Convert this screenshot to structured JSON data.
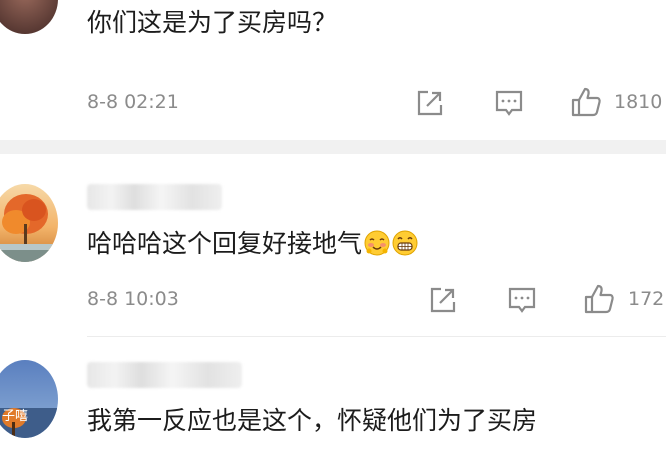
{
  "comments": [
    {
      "text": "你们这是为了买房吗？",
      "time": "8-8 02:21",
      "likes": "1810"
    },
    {
      "text": "哈哈哈这个回复好接地气",
      "time": "8-8 10:03",
      "likes": "172"
    },
    {
      "text": "我第一反应也是这个，怀疑他们为了买房",
      "avatar_caption": "子嘻"
    }
  ],
  "icons": {
    "share": "share-icon",
    "comment": "comment-icon",
    "like": "thumbs-up-icon",
    "emoji1": "blushing-face-emoji",
    "emoji2": "grinning-face-emoji"
  },
  "colors": {
    "text": "#1c1c1c",
    "meta": "#8b8b8b",
    "divider": "#f1f1f1"
  }
}
